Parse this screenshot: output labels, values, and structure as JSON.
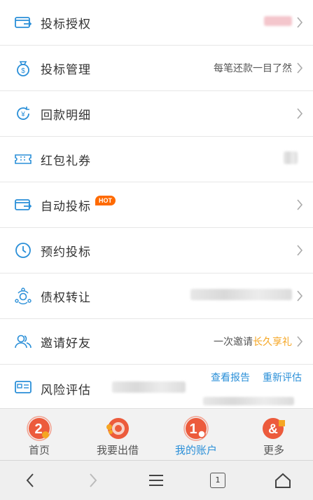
{
  "menu": {
    "items": [
      {
        "label": "投标授权",
        "right": "",
        "icon": "card-arrow-icon"
      },
      {
        "label": "投标管理",
        "right": "每笔还款一目了然",
        "icon": "money-bag-icon"
      },
      {
        "label": "回款明细",
        "right": "",
        "icon": "yuan-refresh-icon"
      },
      {
        "label": "红包礼券",
        "right": "",
        "icon": "coupon-icon"
      },
      {
        "label": "自动投标",
        "right": "",
        "badge": "HOT",
        "icon": "card-arrow-icon"
      },
      {
        "label": "预约投标",
        "right": "",
        "icon": "clock-icon"
      },
      {
        "label": "债权转让",
        "right": "",
        "icon": "transfer-icon"
      },
      {
        "label": "邀请好友",
        "right_prefix": "一次邀请",
        "right_accent": "长久享礼",
        "icon": "friends-icon"
      },
      {
        "label": "风险评估",
        "link_report": "查看报告",
        "link_reassess": "重新评估",
        "icon": "id-card-icon"
      }
    ]
  },
  "tabbar": {
    "tabs": [
      {
        "label": "首页",
        "badge": "2",
        "active": false
      },
      {
        "label": "我要出借",
        "active": false
      },
      {
        "label": "我的账户",
        "badge": "1",
        "active": true
      },
      {
        "label": "更多",
        "active": false
      }
    ]
  },
  "browser": {
    "tab_count": "1"
  },
  "colors": {
    "accent_blue": "#2a8fd8",
    "accent_orange": "#f5a623",
    "hot_badge": "#ff6a00",
    "tab_badge": "#ec5b3c"
  }
}
